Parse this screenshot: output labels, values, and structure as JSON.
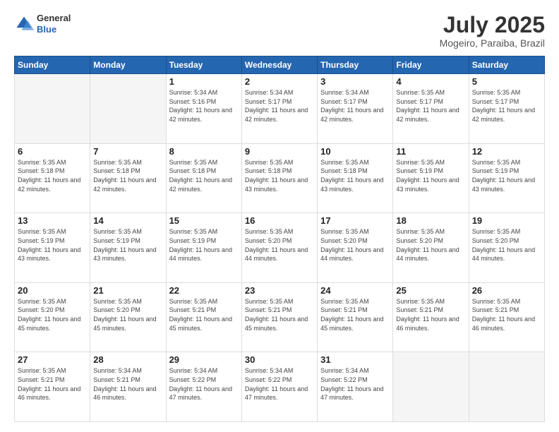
{
  "header": {
    "logo": {
      "general": "General",
      "blue": "Blue"
    },
    "title": "July 2025",
    "location": "Mogeiro, Paraiba, Brazil"
  },
  "weekdays": [
    "Sunday",
    "Monday",
    "Tuesday",
    "Wednesday",
    "Thursday",
    "Friday",
    "Saturday"
  ],
  "weeks": [
    [
      {
        "day": "",
        "empty": true
      },
      {
        "day": "",
        "empty": true
      },
      {
        "day": "1",
        "sunrise": "Sunrise: 5:34 AM",
        "sunset": "Sunset: 5:16 PM",
        "daylight": "Daylight: 11 hours and 42 minutes."
      },
      {
        "day": "2",
        "sunrise": "Sunrise: 5:34 AM",
        "sunset": "Sunset: 5:17 PM",
        "daylight": "Daylight: 11 hours and 42 minutes."
      },
      {
        "day": "3",
        "sunrise": "Sunrise: 5:34 AM",
        "sunset": "Sunset: 5:17 PM",
        "daylight": "Daylight: 11 hours and 42 minutes."
      },
      {
        "day": "4",
        "sunrise": "Sunrise: 5:35 AM",
        "sunset": "Sunset: 5:17 PM",
        "daylight": "Daylight: 11 hours and 42 minutes."
      },
      {
        "day": "5",
        "sunrise": "Sunrise: 5:35 AM",
        "sunset": "Sunset: 5:17 PM",
        "daylight": "Daylight: 11 hours and 42 minutes."
      }
    ],
    [
      {
        "day": "6",
        "sunrise": "Sunrise: 5:35 AM",
        "sunset": "Sunset: 5:18 PM",
        "daylight": "Daylight: 11 hours and 42 minutes."
      },
      {
        "day": "7",
        "sunrise": "Sunrise: 5:35 AM",
        "sunset": "Sunset: 5:18 PM",
        "daylight": "Daylight: 11 hours and 42 minutes."
      },
      {
        "day": "8",
        "sunrise": "Sunrise: 5:35 AM",
        "sunset": "Sunset: 5:18 PM",
        "daylight": "Daylight: 11 hours and 42 minutes."
      },
      {
        "day": "9",
        "sunrise": "Sunrise: 5:35 AM",
        "sunset": "Sunset: 5:18 PM",
        "daylight": "Daylight: 11 hours and 43 minutes."
      },
      {
        "day": "10",
        "sunrise": "Sunrise: 5:35 AM",
        "sunset": "Sunset: 5:18 PM",
        "daylight": "Daylight: 11 hours and 43 minutes."
      },
      {
        "day": "11",
        "sunrise": "Sunrise: 5:35 AM",
        "sunset": "Sunset: 5:19 PM",
        "daylight": "Daylight: 11 hours and 43 minutes."
      },
      {
        "day": "12",
        "sunrise": "Sunrise: 5:35 AM",
        "sunset": "Sunset: 5:19 PM",
        "daylight": "Daylight: 11 hours and 43 minutes."
      }
    ],
    [
      {
        "day": "13",
        "sunrise": "Sunrise: 5:35 AM",
        "sunset": "Sunset: 5:19 PM",
        "daylight": "Daylight: 11 hours and 43 minutes."
      },
      {
        "day": "14",
        "sunrise": "Sunrise: 5:35 AM",
        "sunset": "Sunset: 5:19 PM",
        "daylight": "Daylight: 11 hours and 43 minutes."
      },
      {
        "day": "15",
        "sunrise": "Sunrise: 5:35 AM",
        "sunset": "Sunset: 5:19 PM",
        "daylight": "Daylight: 11 hours and 44 minutes."
      },
      {
        "day": "16",
        "sunrise": "Sunrise: 5:35 AM",
        "sunset": "Sunset: 5:20 PM",
        "daylight": "Daylight: 11 hours and 44 minutes."
      },
      {
        "day": "17",
        "sunrise": "Sunrise: 5:35 AM",
        "sunset": "Sunset: 5:20 PM",
        "daylight": "Daylight: 11 hours and 44 minutes."
      },
      {
        "day": "18",
        "sunrise": "Sunrise: 5:35 AM",
        "sunset": "Sunset: 5:20 PM",
        "daylight": "Daylight: 11 hours and 44 minutes."
      },
      {
        "day": "19",
        "sunrise": "Sunrise: 5:35 AM",
        "sunset": "Sunset: 5:20 PM",
        "daylight": "Daylight: 11 hours and 44 minutes."
      }
    ],
    [
      {
        "day": "20",
        "sunrise": "Sunrise: 5:35 AM",
        "sunset": "Sunset: 5:20 PM",
        "daylight": "Daylight: 11 hours and 45 minutes."
      },
      {
        "day": "21",
        "sunrise": "Sunrise: 5:35 AM",
        "sunset": "Sunset: 5:20 PM",
        "daylight": "Daylight: 11 hours and 45 minutes."
      },
      {
        "day": "22",
        "sunrise": "Sunrise: 5:35 AM",
        "sunset": "Sunset: 5:21 PM",
        "daylight": "Daylight: 11 hours and 45 minutes."
      },
      {
        "day": "23",
        "sunrise": "Sunrise: 5:35 AM",
        "sunset": "Sunset: 5:21 PM",
        "daylight": "Daylight: 11 hours and 45 minutes."
      },
      {
        "day": "24",
        "sunrise": "Sunrise: 5:35 AM",
        "sunset": "Sunset: 5:21 PM",
        "daylight": "Daylight: 11 hours and 45 minutes."
      },
      {
        "day": "25",
        "sunrise": "Sunrise: 5:35 AM",
        "sunset": "Sunset: 5:21 PM",
        "daylight": "Daylight: 11 hours and 46 minutes."
      },
      {
        "day": "26",
        "sunrise": "Sunrise: 5:35 AM",
        "sunset": "Sunset: 5:21 PM",
        "daylight": "Daylight: 11 hours and 46 minutes."
      }
    ],
    [
      {
        "day": "27",
        "sunrise": "Sunrise: 5:35 AM",
        "sunset": "Sunset: 5:21 PM",
        "daylight": "Daylight: 11 hours and 46 minutes."
      },
      {
        "day": "28",
        "sunrise": "Sunrise: 5:34 AM",
        "sunset": "Sunset: 5:21 PM",
        "daylight": "Daylight: 11 hours and 46 minutes."
      },
      {
        "day": "29",
        "sunrise": "Sunrise: 5:34 AM",
        "sunset": "Sunset: 5:22 PM",
        "daylight": "Daylight: 11 hours and 47 minutes."
      },
      {
        "day": "30",
        "sunrise": "Sunrise: 5:34 AM",
        "sunset": "Sunset: 5:22 PM",
        "daylight": "Daylight: 11 hours and 47 minutes."
      },
      {
        "day": "31",
        "sunrise": "Sunrise: 5:34 AM",
        "sunset": "Sunset: 5:22 PM",
        "daylight": "Daylight: 11 hours and 47 minutes."
      },
      {
        "day": "",
        "empty": true
      },
      {
        "day": "",
        "empty": true
      }
    ]
  ]
}
